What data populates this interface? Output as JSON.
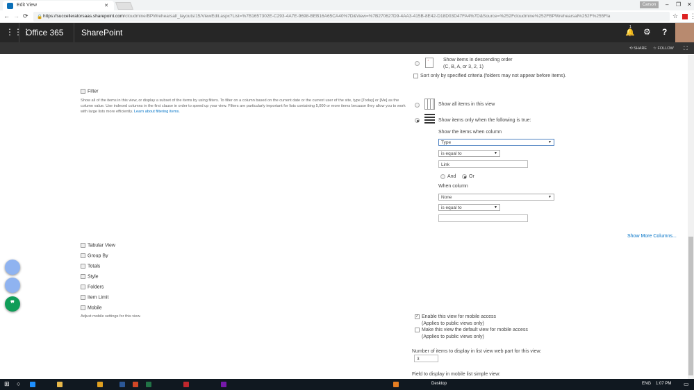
{
  "browser": {
    "tab_title": "Edit View",
    "user": "Carson",
    "url_host": "https://succelleratorsaas.sharepoint.com",
    "url_path": "/cloudmine/BPWrehearsal/_layouts/15/ViewEdit.aspx?List=%7B1657302E-C293-4A7E-9698-BEB16A65CA40%7D&View=%7B270627D9-4AA3-415B-8E42-D18D03D47FA4%7D&Source=%252Fcloudmine%252FBPWrehearsal%252F%255Fla"
  },
  "suite": {
    "app": "Office 365",
    "product": "SharePoint",
    "notif_count": "1"
  },
  "ribbon": {
    "share": "SHARE",
    "follow": "FOLLOW"
  },
  "sort": {
    "desc_label": "Show items in descending order",
    "desc_sub": "(C, B, A, or 3, 2, 1)",
    "only_specified": "Sort only by specified criteria (folders may not appear before items)."
  },
  "filter": {
    "heading": "Filter",
    "desc": "Show all of the items in this view, or display a subset of the items by using filters. To filter on a column based on the current date or the current user of the site, type [Today] or [Me] as the column value. Use indexed columns in the first clause in order to speed up your view. Filters are particularly important for lists containing 5,000 or more items because they allow you to work with large lists more efficiently.",
    "learn": "Learn about filtering items.",
    "show_all": "Show all items in this view",
    "show_only": "Show items only when the following is true:",
    "when_col1": "Show the items when column",
    "col1": "Type",
    "op1": "is equal to",
    "val1": "Link",
    "and": "And",
    "or": "Or",
    "when_col2": "When column",
    "col2": "None",
    "op2": "is equal to",
    "val2": "",
    "more": "Show More Columns..."
  },
  "sections": [
    "Tabular View",
    "Group By",
    "Totals",
    "Style",
    "Folders",
    "Item Limit",
    "Mobile"
  ],
  "mobile": {
    "desc": "Adjust mobile settings for this view.",
    "enable": "Enable this view for mobile access",
    "applies1": "(Applies to public views only)",
    "default": "Make this view the default view for mobile access",
    "applies2": "(Applies to public views only)",
    "num_label": "Number of items to display in list view web part for this view:",
    "num_value": "3",
    "field_label": "Field to display in mobile list simple view:"
  },
  "taskbar": {
    "desktop": "Desktop",
    "lang": "ENG",
    "time": "1:07 PM"
  }
}
